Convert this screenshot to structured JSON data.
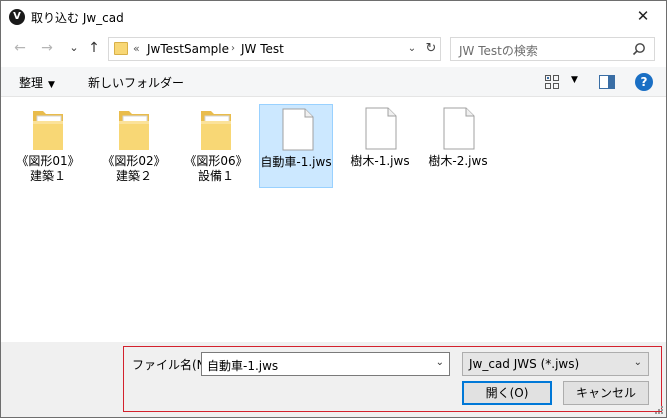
{
  "window": {
    "title": "取り込む Jw_cad",
    "app_icon_glyph": "V",
    "close_glyph": "✕"
  },
  "nav": {
    "back_glyph": "←",
    "forward_glyph": "→",
    "recent_glyph": "⌄",
    "up_glyph": "↑",
    "breadcrumb_prefix": "«",
    "breadcrumbs": [
      "JwTestSample",
      "JW Test"
    ],
    "crumb_arrow": "›",
    "address_dropdown_glyph": "⌄",
    "refresh_glyph": "↻"
  },
  "search": {
    "placeholder": "JW Testの検索"
  },
  "toolbar": {
    "organize_label": "整理",
    "organize_caret": "▼",
    "new_folder_label": "新しいフォルダー",
    "view_caret": "▼",
    "help_glyph": "?"
  },
  "files": [
    {
      "type": "folder",
      "label": "《図形01》建築１",
      "selected": false
    },
    {
      "type": "folder",
      "label": "《図形02》建築２",
      "selected": false
    },
    {
      "type": "folder",
      "label": "《図形06》設備１",
      "selected": false
    },
    {
      "type": "file",
      "label": "自動車-1.jws",
      "selected": true
    },
    {
      "type": "file",
      "label": "樹木-1.jws",
      "selected": false
    },
    {
      "type": "file",
      "label": "樹木-2.jws",
      "selected": false
    }
  ],
  "bottom": {
    "filename_label": "ファイル名(N):",
    "filename_value": "自動車-1.jws",
    "filename_dropdown_glyph": "⌄",
    "filetype_value": "Jw_cad JWS (*.jws)",
    "filetype_dropdown_glyph": "⌄",
    "open_label": "開く(O)",
    "cancel_label": "キャンセル"
  },
  "colors": {
    "selection_bg": "#cce8ff",
    "selection_border": "#99d1ff",
    "highlight_box": "#d3212d",
    "primary_border": "#0078d7",
    "folder_yellow": "#f8d775"
  }
}
